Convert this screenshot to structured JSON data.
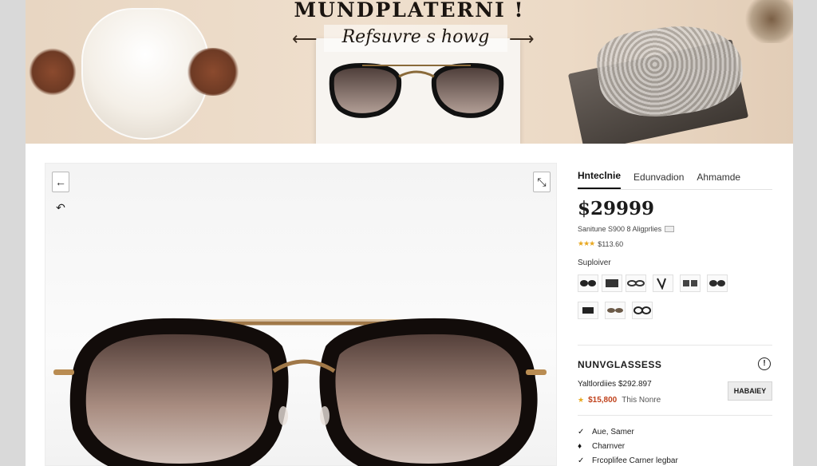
{
  "hero": {
    "title": "MUNDPLATERNI !",
    "subtitle": "Refsuvre s howg",
    "arrow_left": "⟵",
    "arrow_right": "⟶"
  },
  "gallery": {
    "back_icon": "arrow-left-icon",
    "undo_icon": "rotate-icon",
    "expand_icon": "expand-icon"
  },
  "panel": {
    "tabs": [
      "Hnteclnie",
      "Edunvadion",
      "Ahmamde"
    ],
    "price": "$29999",
    "shipping_text": "Sanitune S900 8 Aligprlies",
    "rating_text": "$113.60",
    "swatch_label": "Suploiver",
    "product_name": "NUNVGLASSESS",
    "seller_text": "Yaltlordiies $292.897",
    "sale_price": "$15,800",
    "sale_note": "This Nonre",
    "cart_label": "HABAIEY",
    "features": [
      "Aue, Samer",
      "Charnver",
      "Frcoplifee Carner legbar"
    ]
  }
}
